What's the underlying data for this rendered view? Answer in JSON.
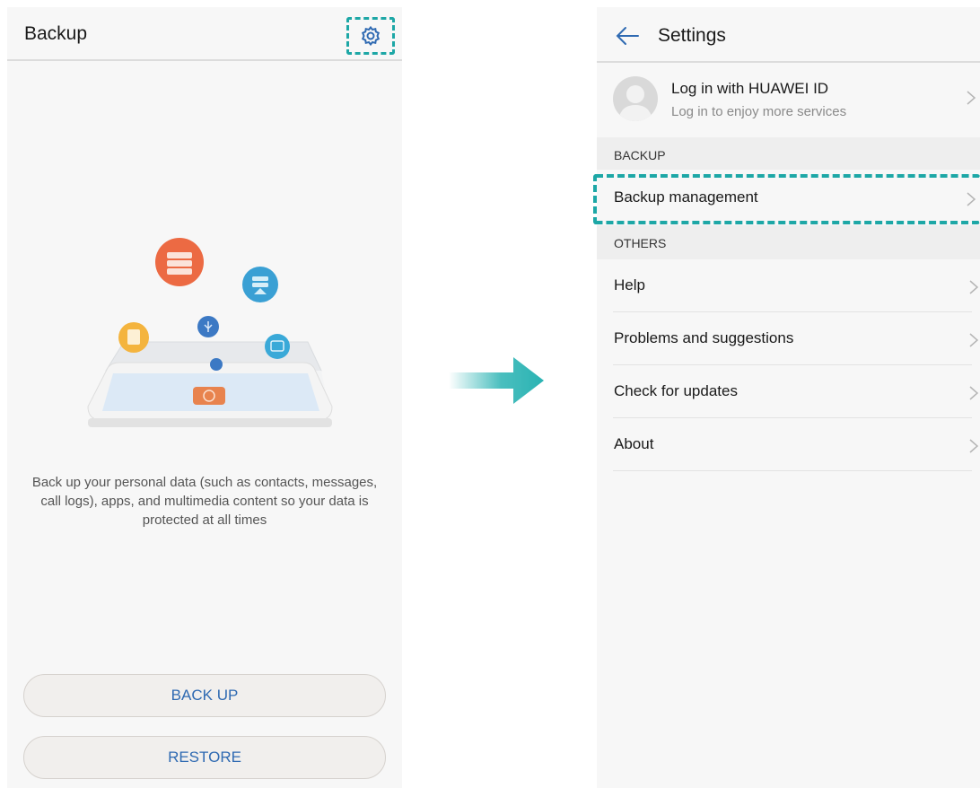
{
  "left": {
    "title": "Backup",
    "description": "Back up your personal data (such as contacts, messages, call logs), apps, and multimedia content so your data is protected at all times",
    "backup_label": "BACK UP",
    "restore_label": "RESTORE",
    "settings_icon": "gear-icon"
  },
  "right": {
    "title": "Settings",
    "account": {
      "title": "Log in with HUAWEI ID",
      "subtitle": "Log in to enjoy more services"
    },
    "sections": {
      "backup": "BACKUP",
      "others": "OTHERS"
    },
    "backup_items": [
      {
        "label": "Backup management"
      }
    ],
    "other_items": [
      {
        "label": "Help"
      },
      {
        "label": "Problems and suggestions"
      },
      {
        "label": "Check for updates"
      },
      {
        "label": "About"
      }
    ]
  },
  "colors": {
    "highlight": "#1da7a6",
    "button_text": "#2f6ab2",
    "arrow": "#2ab3b3"
  }
}
